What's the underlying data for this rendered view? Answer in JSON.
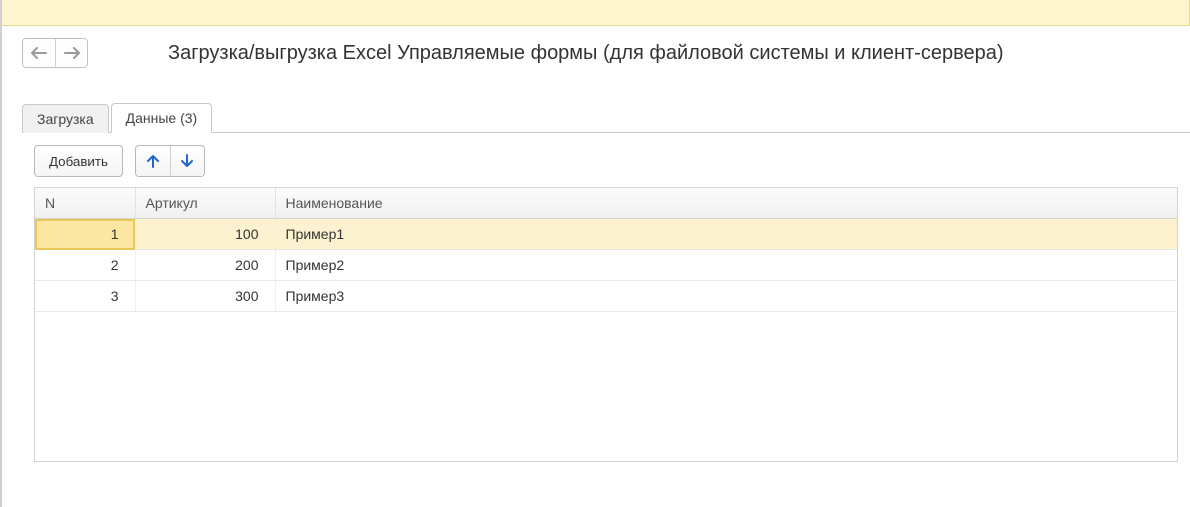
{
  "header": {
    "title": "Загрузка/выгрузка Excel Управляемые формы (для файловой системы и клиент-сервера)"
  },
  "tabs": [
    {
      "label": "Загрузка",
      "active": false
    },
    {
      "label": "Данные (3)",
      "active": true
    }
  ],
  "toolbar": {
    "add_label": "Добавить"
  },
  "table": {
    "columns": {
      "n": "N",
      "art": "Артикул",
      "name": "Наименование"
    },
    "rows": [
      {
        "n": "1",
        "art": "100",
        "name": "Пример1",
        "selected": true
      },
      {
        "n": "2",
        "art": "200",
        "name": "Пример2",
        "selected": false
      },
      {
        "n": "3",
        "art": "300",
        "name": "Пример3",
        "selected": false
      }
    ]
  }
}
